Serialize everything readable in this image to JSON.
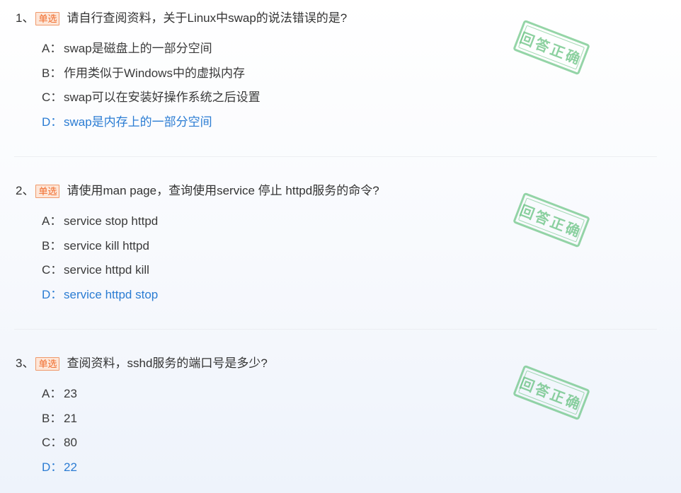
{
  "questions": [
    {
      "number": "1、",
      "tag": "单选",
      "text": "请自行查阅资料，关于Linux中swap的说法错误的是?",
      "options": [
        {
          "letter": "A：",
          "text": "swap是磁盘上的一部分空间",
          "selected": false
        },
        {
          "letter": "B：",
          "text": "作用类似于Windows中的虚拟内存",
          "selected": false
        },
        {
          "letter": "C：",
          "text": "swap可以在安装好操作系统之后设置",
          "selected": false
        },
        {
          "letter": "D：",
          "text": "swap是内存上的一部分空间",
          "selected": true
        }
      ],
      "stamp": "回答正确"
    },
    {
      "number": "2、",
      "tag": "单选",
      "text": "请使用man page，查询使用service 停止 httpd服务的命令?",
      "options": [
        {
          "letter": "A：",
          "text": "service stop httpd",
          "selected": false
        },
        {
          "letter": "B：",
          "text": "service kill httpd",
          "selected": false
        },
        {
          "letter": "C：",
          "text": "service httpd kill",
          "selected": false
        },
        {
          "letter": "D：",
          "text": "service httpd stop",
          "selected": true
        }
      ],
      "stamp": "回答正确"
    },
    {
      "number": "3、",
      "tag": "单选",
      "text": "查阅资料，sshd服务的端口号是多少?",
      "options": [
        {
          "letter": "A：",
          "text": "23",
          "selected": false
        },
        {
          "letter": "B：",
          "text": "21",
          "selected": false
        },
        {
          "letter": "C：",
          "text": "80",
          "selected": false
        },
        {
          "letter": "D：",
          "text": "22",
          "selected": true
        }
      ],
      "stamp": "回答正确"
    }
  ],
  "colors": {
    "selected": "#2b7cd3",
    "tag_border": "#f0986a",
    "tag_bg": "#fde6d8",
    "tag_text": "#f06a2a",
    "stamp": "#5cbe78"
  }
}
